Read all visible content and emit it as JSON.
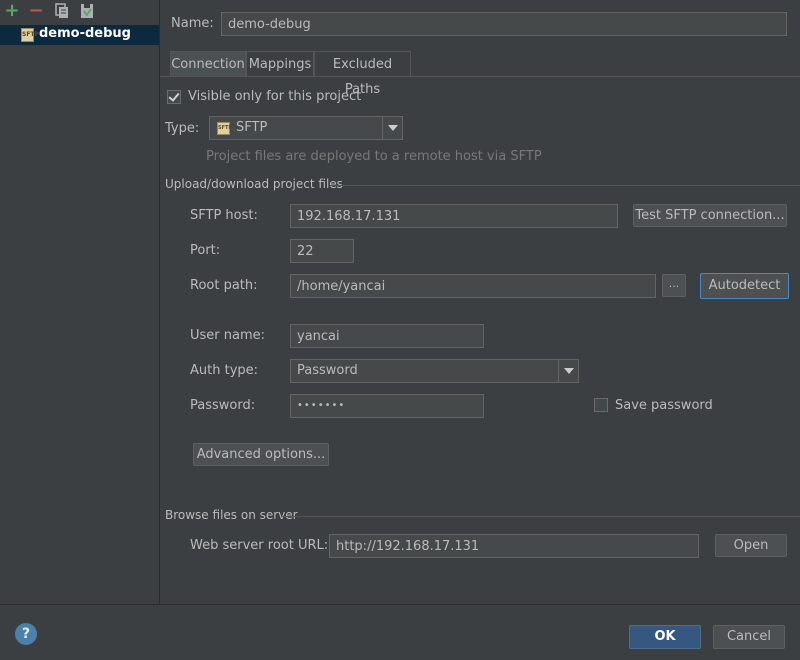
{
  "toolbar": {
    "add_icon": "plus-icon",
    "remove_icon": "minus-icon",
    "copy_icon": "copy-icon",
    "save_icon": "save-icon"
  },
  "tree": {
    "items": [
      {
        "label": "demo-debug",
        "icon": "sftp-server-icon",
        "selected": true
      }
    ]
  },
  "name": {
    "label": "Name:",
    "value": "demo-debug"
  },
  "tabs": [
    {
      "label": "Connection",
      "active": true
    },
    {
      "label": "Mappings",
      "active": false
    },
    {
      "label": "Excluded Paths",
      "active": false
    }
  ],
  "visible_only": {
    "label": "Visible only for this project",
    "checked": true
  },
  "type": {
    "label": "Type:",
    "value": "SFTP",
    "hint": "Project files are deployed to a remote host via SFTP"
  },
  "upload_section": {
    "title": "Upload/download project files"
  },
  "sftp_host": {
    "label": "SFTP host:",
    "value": "192.168.17.131",
    "test_button": "Test SFTP connection..."
  },
  "port": {
    "label": "Port:",
    "value": "22"
  },
  "root_path": {
    "label": "Root path:",
    "value": "/home/yancai",
    "browse_button": "...",
    "autodetect_button": "Autodetect"
  },
  "user_name": {
    "label": "User name:",
    "value": "yancai"
  },
  "auth_type": {
    "label": "Auth type:",
    "value": "Password"
  },
  "password": {
    "label": "Password:",
    "value": "•••••••"
  },
  "save_password": {
    "label": "Save password",
    "checked": false
  },
  "advanced_button": "Advanced options...",
  "browse_section": {
    "title": "Browse files on server"
  },
  "web_root": {
    "label": "Web server root URL:",
    "value": "http://192.168.17.131",
    "open_button": "Open"
  },
  "footer": {
    "help": "?",
    "ok": "OK",
    "cancel": "Cancel"
  },
  "colors": {
    "background": "#3c3f41",
    "selection": "#0d293e",
    "primary_button": "#365880",
    "add": "#59a869",
    "remove": "#c75450"
  }
}
